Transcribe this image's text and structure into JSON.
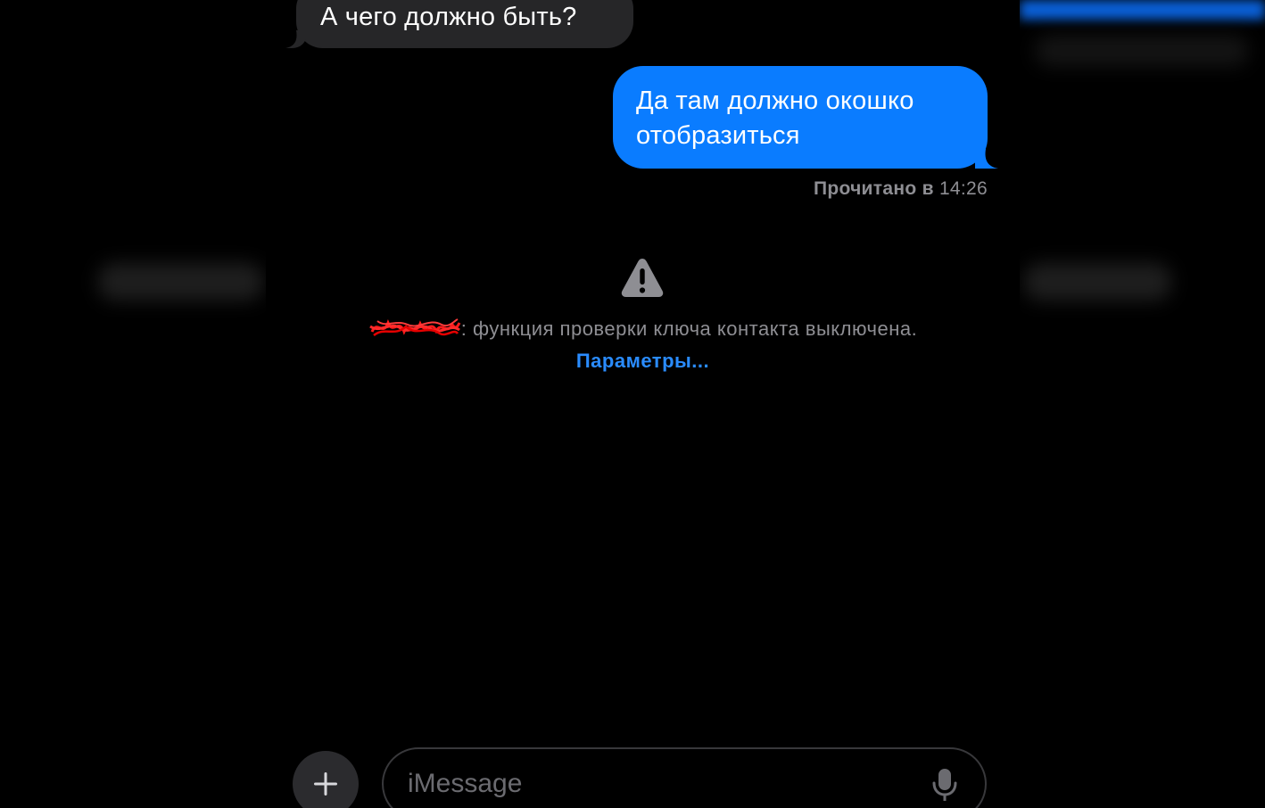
{
  "conversation": {
    "messages": [
      {
        "direction": "incoming",
        "text": "А чего должно быть?"
      },
      {
        "direction": "outgoing",
        "line1": "Да там должно окошко",
        "line2": "отобразиться"
      }
    ],
    "read_receipt": {
      "label": "Прочитано в",
      "time": "14:26"
    }
  },
  "notice": {
    "icon": "warning-icon",
    "text": ": функция проверки ключа контакта выключена.",
    "link": "Параметры..."
  },
  "composer": {
    "plus_icon": "plus-icon",
    "placeholder": "iMessage",
    "mic_icon": "microphone-icon"
  },
  "colors": {
    "incoming_bubble": "#262628",
    "outgoing_bubble": "#0a7cff",
    "link": "#2a8cff",
    "secondary_text": "#8e8e93"
  }
}
